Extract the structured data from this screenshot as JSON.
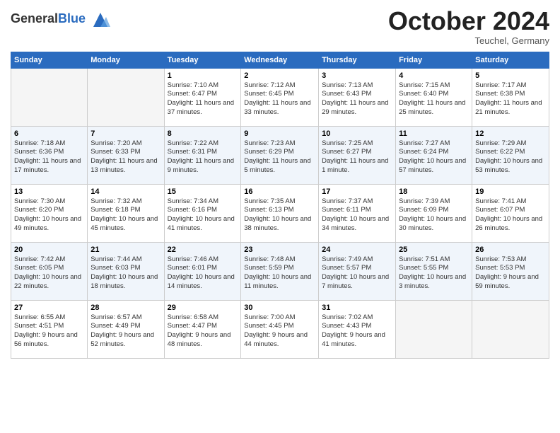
{
  "header": {
    "logo_general": "General",
    "logo_blue": "Blue",
    "month": "October 2024",
    "location": "Teuchel, Germany"
  },
  "weekdays": [
    "Sunday",
    "Monday",
    "Tuesday",
    "Wednesday",
    "Thursday",
    "Friday",
    "Saturday"
  ],
  "weeks": [
    [
      null,
      null,
      {
        "day": 1,
        "sunrise": "Sunrise: 7:10 AM",
        "sunset": "Sunset: 6:47 PM",
        "daylight": "Daylight: 11 hours and 37 minutes."
      },
      {
        "day": 2,
        "sunrise": "Sunrise: 7:12 AM",
        "sunset": "Sunset: 6:45 PM",
        "daylight": "Daylight: 11 hours and 33 minutes."
      },
      {
        "day": 3,
        "sunrise": "Sunrise: 7:13 AM",
        "sunset": "Sunset: 6:43 PM",
        "daylight": "Daylight: 11 hours and 29 minutes."
      },
      {
        "day": 4,
        "sunrise": "Sunrise: 7:15 AM",
        "sunset": "Sunset: 6:40 PM",
        "daylight": "Daylight: 11 hours and 25 minutes."
      },
      {
        "day": 5,
        "sunrise": "Sunrise: 7:17 AM",
        "sunset": "Sunset: 6:38 PM",
        "daylight": "Daylight: 11 hours and 21 minutes."
      }
    ],
    [
      {
        "day": 6,
        "sunrise": "Sunrise: 7:18 AM",
        "sunset": "Sunset: 6:36 PM",
        "daylight": "Daylight: 11 hours and 17 minutes."
      },
      {
        "day": 7,
        "sunrise": "Sunrise: 7:20 AM",
        "sunset": "Sunset: 6:33 PM",
        "daylight": "Daylight: 11 hours and 13 minutes."
      },
      {
        "day": 8,
        "sunrise": "Sunrise: 7:22 AM",
        "sunset": "Sunset: 6:31 PM",
        "daylight": "Daylight: 11 hours and 9 minutes."
      },
      {
        "day": 9,
        "sunrise": "Sunrise: 7:23 AM",
        "sunset": "Sunset: 6:29 PM",
        "daylight": "Daylight: 11 hours and 5 minutes."
      },
      {
        "day": 10,
        "sunrise": "Sunrise: 7:25 AM",
        "sunset": "Sunset: 6:27 PM",
        "daylight": "Daylight: 11 hours and 1 minute."
      },
      {
        "day": 11,
        "sunrise": "Sunrise: 7:27 AM",
        "sunset": "Sunset: 6:24 PM",
        "daylight": "Daylight: 10 hours and 57 minutes."
      },
      {
        "day": 12,
        "sunrise": "Sunrise: 7:29 AM",
        "sunset": "Sunset: 6:22 PM",
        "daylight": "Daylight: 10 hours and 53 minutes."
      }
    ],
    [
      {
        "day": 13,
        "sunrise": "Sunrise: 7:30 AM",
        "sunset": "Sunset: 6:20 PM",
        "daylight": "Daylight: 10 hours and 49 minutes."
      },
      {
        "day": 14,
        "sunrise": "Sunrise: 7:32 AM",
        "sunset": "Sunset: 6:18 PM",
        "daylight": "Daylight: 10 hours and 45 minutes."
      },
      {
        "day": 15,
        "sunrise": "Sunrise: 7:34 AM",
        "sunset": "Sunset: 6:16 PM",
        "daylight": "Daylight: 10 hours and 41 minutes."
      },
      {
        "day": 16,
        "sunrise": "Sunrise: 7:35 AM",
        "sunset": "Sunset: 6:13 PM",
        "daylight": "Daylight: 10 hours and 38 minutes."
      },
      {
        "day": 17,
        "sunrise": "Sunrise: 7:37 AM",
        "sunset": "Sunset: 6:11 PM",
        "daylight": "Daylight: 10 hours and 34 minutes."
      },
      {
        "day": 18,
        "sunrise": "Sunrise: 7:39 AM",
        "sunset": "Sunset: 6:09 PM",
        "daylight": "Daylight: 10 hours and 30 minutes."
      },
      {
        "day": 19,
        "sunrise": "Sunrise: 7:41 AM",
        "sunset": "Sunset: 6:07 PM",
        "daylight": "Daylight: 10 hours and 26 minutes."
      }
    ],
    [
      {
        "day": 20,
        "sunrise": "Sunrise: 7:42 AM",
        "sunset": "Sunset: 6:05 PM",
        "daylight": "Daylight: 10 hours and 22 minutes."
      },
      {
        "day": 21,
        "sunrise": "Sunrise: 7:44 AM",
        "sunset": "Sunset: 6:03 PM",
        "daylight": "Daylight: 10 hours and 18 minutes."
      },
      {
        "day": 22,
        "sunrise": "Sunrise: 7:46 AM",
        "sunset": "Sunset: 6:01 PM",
        "daylight": "Daylight: 10 hours and 14 minutes."
      },
      {
        "day": 23,
        "sunrise": "Sunrise: 7:48 AM",
        "sunset": "Sunset: 5:59 PM",
        "daylight": "Daylight: 10 hours and 11 minutes."
      },
      {
        "day": 24,
        "sunrise": "Sunrise: 7:49 AM",
        "sunset": "Sunset: 5:57 PM",
        "daylight": "Daylight: 10 hours and 7 minutes."
      },
      {
        "day": 25,
        "sunrise": "Sunrise: 7:51 AM",
        "sunset": "Sunset: 5:55 PM",
        "daylight": "Daylight: 10 hours and 3 minutes."
      },
      {
        "day": 26,
        "sunrise": "Sunrise: 7:53 AM",
        "sunset": "Sunset: 5:53 PM",
        "daylight": "Daylight: 9 hours and 59 minutes."
      }
    ],
    [
      {
        "day": 27,
        "sunrise": "Sunrise: 6:55 AM",
        "sunset": "Sunset: 4:51 PM",
        "daylight": "Daylight: 9 hours and 56 minutes."
      },
      {
        "day": 28,
        "sunrise": "Sunrise: 6:57 AM",
        "sunset": "Sunset: 4:49 PM",
        "daylight": "Daylight: 9 hours and 52 minutes."
      },
      {
        "day": 29,
        "sunrise": "Sunrise: 6:58 AM",
        "sunset": "Sunset: 4:47 PM",
        "daylight": "Daylight: 9 hours and 48 minutes."
      },
      {
        "day": 30,
        "sunrise": "Sunrise: 7:00 AM",
        "sunset": "Sunset: 4:45 PM",
        "daylight": "Daylight: 9 hours and 44 minutes."
      },
      {
        "day": 31,
        "sunrise": "Sunrise: 7:02 AM",
        "sunset": "Sunset: 4:43 PM",
        "daylight": "Daylight: 9 hours and 41 minutes."
      },
      null,
      null
    ]
  ]
}
